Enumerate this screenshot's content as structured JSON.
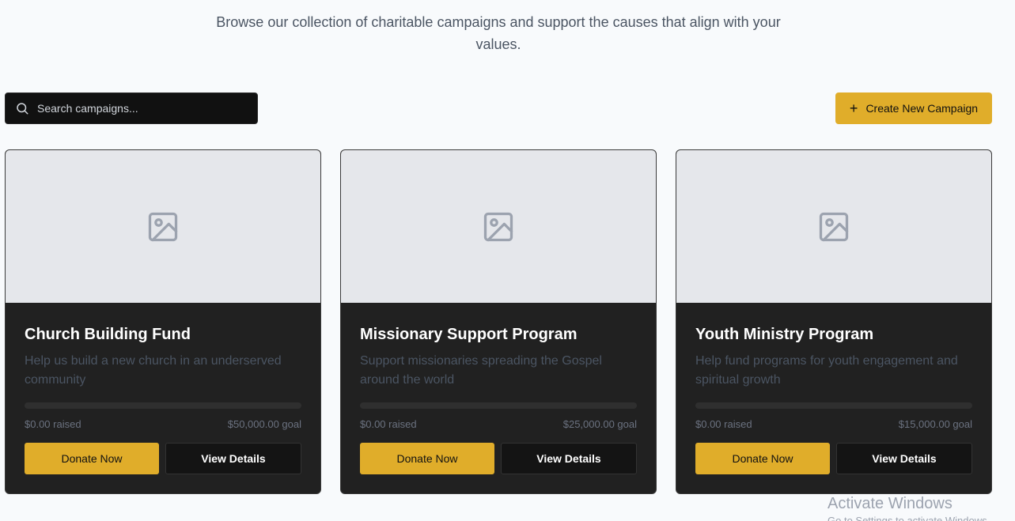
{
  "intro": {
    "text": "Browse our collection of charitable campaigns and support the causes that align with your values."
  },
  "search": {
    "placeholder": "Search campaigns..."
  },
  "create_button": {
    "label": "Create New Campaign"
  },
  "campaigns": [
    {
      "title": "Church Building Fund",
      "description": "Help us build a new church in an underserved community",
      "raised": "$0.00 raised",
      "goal": "$50,000.00 goal",
      "progress": 0,
      "donate_label": "Donate Now",
      "details_label": "View Details"
    },
    {
      "title": "Missionary Support Program",
      "description": "Support missionaries spreading the Gospel around the world",
      "raised": "$0.00 raised",
      "goal": "$25,000.00 goal",
      "progress": 0,
      "donate_label": "Donate Now",
      "details_label": "View Details"
    },
    {
      "title": "Youth Ministry Program",
      "description": "Help fund programs for youth engagement and spiritual growth",
      "raised": "$0.00 raised",
      "goal": "$15,000.00 goal",
      "progress": 0,
      "donate_label": "Donate Now",
      "details_label": "View Details"
    }
  ],
  "watermark": {
    "title": "Activate Windows",
    "subtitle": "Go to Settings to activate Windows."
  },
  "colors": {
    "accent": "#e0ad2a",
    "card_bg": "#212121",
    "page_bg": "#f8fafc"
  },
  "icons": {
    "search": "search-icon",
    "plus": "plus-icon",
    "image_placeholder": "image-placeholder-icon"
  }
}
